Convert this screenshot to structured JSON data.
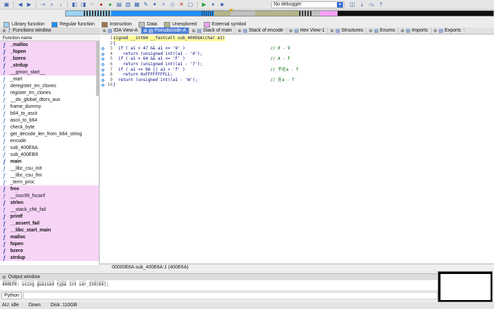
{
  "toolbar": {
    "debugger_value": "No debugger"
  },
  "legend": [
    {
      "label": "Library function",
      "color": "#9ad3f4"
    },
    {
      "label": "Regular function",
      "color": "#1e90ff"
    },
    {
      "label": "Instruction",
      "color": "#a0764a"
    },
    {
      "label": "Data",
      "color": "#c0c0c0"
    },
    {
      "label": "Unexplored",
      "color": "#b5b58a"
    },
    {
      "label": "External symbol",
      "color": "#f6a0f6"
    }
  ],
  "tabs": [
    {
      "label": "IDA View-A"
    },
    {
      "label": "Pseudocode-A"
    },
    {
      "label": "Stack of main"
    },
    {
      "label": "Stack of encode"
    },
    {
      "label": "Hex View-1"
    },
    {
      "label": "Structures"
    },
    {
      "label": "Enums"
    },
    {
      "label": "Imports"
    },
    {
      "label": "Exports"
    }
  ],
  "functions_window": {
    "title": "Functions window",
    "column_header": "Function name",
    "items": [
      {
        "name": "_malloc",
        "style": "pink-bold"
      },
      {
        "name": "_fopen",
        "style": "pink-bold"
      },
      {
        "name": "_bzero",
        "style": "pink-bold"
      },
      {
        "name": "_strdup",
        "style": "pink-bold"
      },
      {
        "name": "__gmon_start__",
        "style": "pink"
      },
      {
        "name": "_start",
        "style": "normal"
      },
      {
        "name": "deregister_tm_clones",
        "style": "normal"
      },
      {
        "name": "register_tm_clones",
        "style": "normal"
      },
      {
        "name": "__do_global_dtors_aux",
        "style": "normal"
      },
      {
        "name": "frame_dummy",
        "style": "normal"
      },
      {
        "name": "b64_to_ascii",
        "style": "normal"
      },
      {
        "name": "ascii_to_b64",
        "style": "normal"
      },
      {
        "name": "check_byte",
        "style": "normal"
      },
      {
        "name": "get_decode_len_from_b64_string",
        "style": "normal"
      },
      {
        "name": "encode",
        "style": "normal"
      },
      {
        "name": "sub_400E6A",
        "style": "normal"
      },
      {
        "name": "sub_400EB9",
        "style": "normal"
      },
      {
        "name": "main",
        "style": "bold"
      },
      {
        "name": "__libc_csu_init",
        "style": "normal"
      },
      {
        "name": "__libc_csu_fini",
        "style": "normal"
      },
      {
        "name": "_term_proc",
        "style": "normal"
      },
      {
        "name": "free",
        "style": "pink-bold"
      },
      {
        "name": "__isoc99_fscanf",
        "style": "pink"
      },
      {
        "name": "strlen",
        "style": "pink-bold"
      },
      {
        "name": "__stack_chk_fail",
        "style": "pink"
      },
      {
        "name": "printf",
        "style": "pink-bold"
      },
      {
        "name": "__assert_fail",
        "style": "pink-bold"
      },
      {
        "name": "__libc_start_main",
        "style": "pink-bold"
      },
      {
        "name": "malloc",
        "style": "pink-bold"
      },
      {
        "name": "fopen",
        "style": "pink-bold"
      },
      {
        "name": "bzero",
        "style": "pink-bold"
      },
      {
        "name": "strdup",
        "style": "pink-bold"
      }
    ]
  },
  "code": [
    {
      "n": "1",
      "text": "signed __int64 __fastcall sub_400E6A(char a1)",
      "comment": "",
      "dot": false
    },
    {
      "n": "2",
      "text": "{",
      "comment": "",
      "dot": false
    },
    {
      "n": "3",
      "text": "  if ( a1 > 47 && a1 <= '9' )",
      "comment": "// 0 - 9",
      "dot": true
    },
    {
      "n": "4",
      "text": "    return (unsigned int)(a1 - '0');",
      "comment": "",
      "dot": true
    },
    {
      "n": "5",
      "text": "  if ( a1 > 64 && a1 <= 'F' )",
      "comment": "// A - F",
      "dot": true
    },
    {
      "n": "6",
      "text": "    return (unsigned int)(a1 - '7');",
      "comment": "",
      "dot": true
    },
    {
      "n": "7",
      "text": "  if ( a1 <= 96 || a1 > 'f' )",
      "comment": "// 不在a - f",
      "dot": true
    },
    {
      "n": "8",
      "text": "    return 0xFFFFFFFFLL;",
      "comment": "",
      "dot": true
    },
    {
      "n": "9",
      "text": "  return (unsigned int)(a1 - 'W');",
      "comment": "// 在a - f",
      "dot": true
    },
    {
      "n": "10",
      "text": "}",
      "comment": "",
      "dot": true
    }
  ],
  "code_status": "00000E6A sub_400E6A:1 (400E6A)",
  "output_window": {
    "title": "Output window",
    "line_faded": "400EB9: using guessed type int var_150[64];",
    "line": "400EF0: using guessed type int var_150[64];",
    "python_button": "Python"
  },
  "statusbar": {
    "au": "AU:",
    "state": "idle",
    "direction": "Down",
    "disk": "Disk: 110GB"
  }
}
